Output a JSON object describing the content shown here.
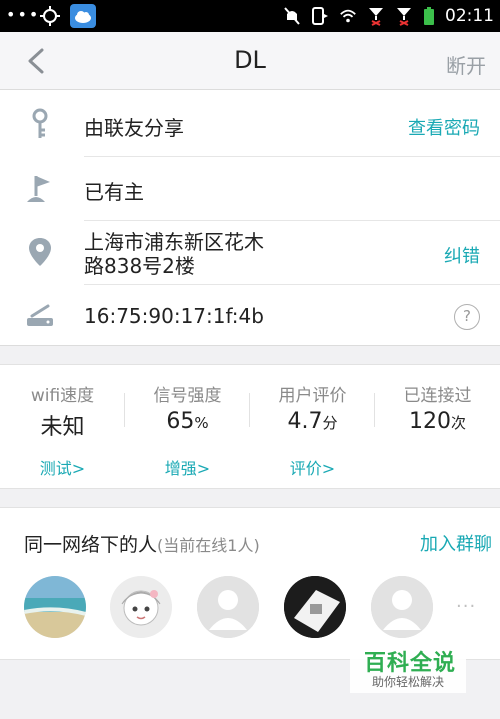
{
  "status_bar": {
    "time": "02:11"
  },
  "header": {
    "title": "DL",
    "disconnect_label": "断开"
  },
  "info": {
    "share": {
      "text": "由联友分享",
      "action": "查看密码"
    },
    "owner": {
      "text": "已有主"
    },
    "location": {
      "line1": "上海市浦东新区花木",
      "line2": "路838号2楼",
      "action": "纠错"
    },
    "mac": {
      "text": "16:75:90:17:1f:4b",
      "help": "?"
    }
  },
  "stats": [
    {
      "label": "wifi速度",
      "value": "未知",
      "unit": "",
      "action": "测试>"
    },
    {
      "label": "信号强度",
      "value": "65",
      "unit": "%",
      "action": "增强>"
    },
    {
      "label": "用户评价",
      "value": "4.7",
      "unit": "分",
      "action": "评价>"
    },
    {
      "label": "已连接过",
      "value": "120",
      "unit": "次",
      "action": ""
    }
  ],
  "people": {
    "title": "同一网络下的人",
    "subtitle": "(当前在线1人)",
    "join_label": "加入群聊",
    "more": "···"
  },
  "watermark": {
    "brand": "百科全说",
    "tagline": "助你轻松解决"
  },
  "colors": {
    "accent": "#1aa9b4",
    "muted": "#8a8a8a",
    "icon": "#9aa7b2"
  }
}
